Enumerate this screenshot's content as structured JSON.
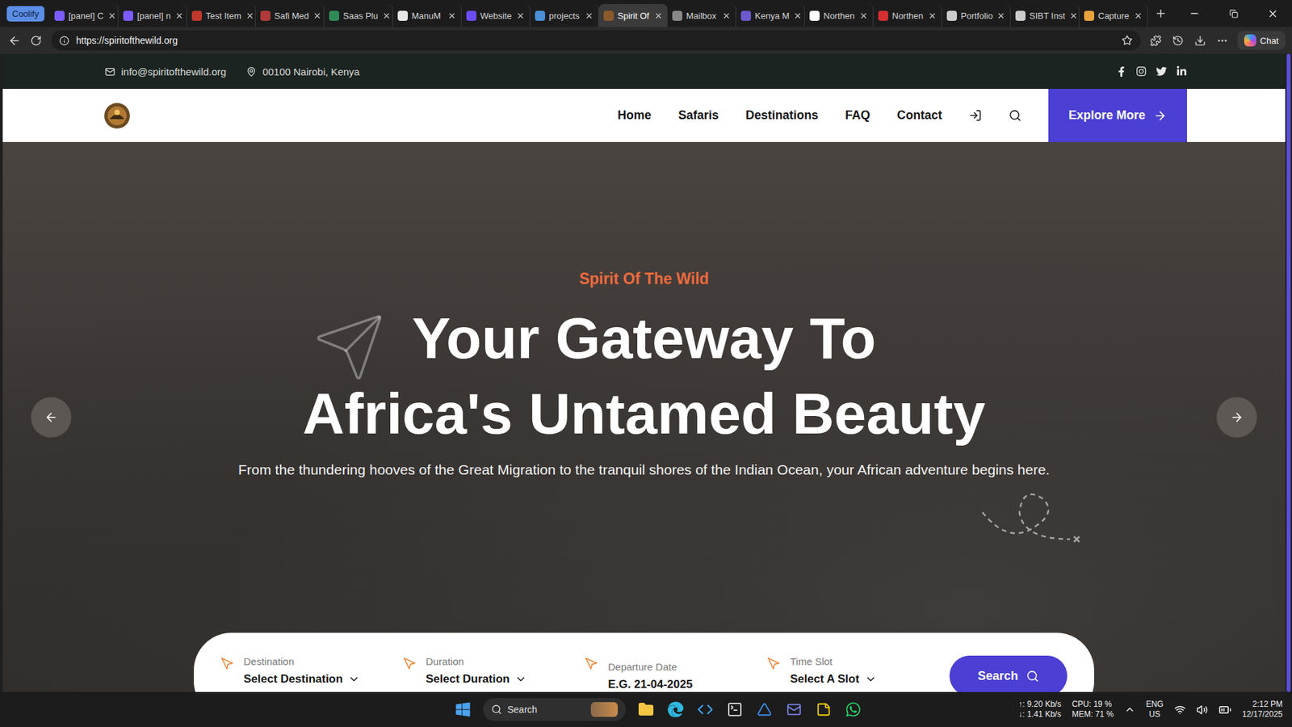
{
  "browser": {
    "tab_group": {
      "label": "Coolify"
    },
    "tabs": [
      {
        "label": "[panel] C",
        "selected": false,
        "color": "#7c5cff"
      },
      {
        "label": "[panel] n",
        "selected": false,
        "color": "#7c5cff"
      },
      {
        "label": "Test Item",
        "selected": false,
        "color": "#c0392b"
      },
      {
        "label": "Safi Med",
        "selected": false,
        "color": "#b23a3a"
      },
      {
        "label": "Saas Plu",
        "selected": false,
        "color": "#2e8b57"
      },
      {
        "label": "ManuM",
        "selected": false,
        "color": "#e6e6e6"
      },
      {
        "label": "Website",
        "selected": false,
        "color": "#6c4cf0"
      },
      {
        "label": "projects",
        "selected": false,
        "color": "#4a90d9"
      },
      {
        "label": "Spirit Of",
        "selected": true,
        "color": "#8b5a2b"
      },
      {
        "label": "Mailbox",
        "selected": false,
        "color": "#888888"
      },
      {
        "label": "Kenya M",
        "selected": false,
        "color": "#6a5acd"
      },
      {
        "label": "Northen",
        "selected": false,
        "color": "#ffffff"
      },
      {
        "label": "Northen",
        "selected": false,
        "color": "#d32f2f"
      },
      {
        "label": "Portfolio",
        "selected": false,
        "color": "#cccccc"
      },
      {
        "label": "SIBT Inst",
        "selected": false,
        "color": "#cccccc"
      },
      {
        "label": "Capture",
        "selected": false,
        "color": "#e8a33c"
      }
    ],
    "url": "https://spiritofthewild.org",
    "chat_button": "Chat"
  },
  "site": {
    "topbar": {
      "email": "info@spiritofthewild.org",
      "location": "00100 Nairobi, Kenya"
    },
    "nav": {
      "items": [
        {
          "label": "Home"
        },
        {
          "label": "Safaris"
        },
        {
          "label": "Destinations"
        },
        {
          "label": "FAQ"
        },
        {
          "label": "Contact"
        }
      ],
      "cta": "Explore More"
    },
    "hero": {
      "eyebrow": "Spirit Of The Wild",
      "title_lines": [
        "Your Gateway To",
        "Africa's Untamed Beauty"
      ],
      "description": "From the thundering hooves of the Great Migration to the tranquil shores of the Indian Ocean, your African adventure begins here."
    },
    "search_form": {
      "fields": [
        {
          "label": "Destination",
          "value": "Select Destination",
          "kind": "select"
        },
        {
          "label": "Duration",
          "value": "Select Duration",
          "kind": "select"
        },
        {
          "label": "Departure Date",
          "value": "E.G. 21-04-2025",
          "kind": "date"
        },
        {
          "label": "Time Slot",
          "value": "Select A Slot",
          "kind": "select"
        }
      ],
      "button": "Search"
    }
  },
  "taskbar": {
    "search_placeholder": "Search",
    "network": {
      "up": "↑: 9.20 Kb/s",
      "down": "↓: 1.41 Kb/s"
    },
    "cpu": "CPU: 19 %",
    "mem": "MEM: 71 %",
    "language": {
      "lang": "ENG",
      "region": "US"
    },
    "time": "2:12 PM",
    "date": "12/17/2025"
  }
}
